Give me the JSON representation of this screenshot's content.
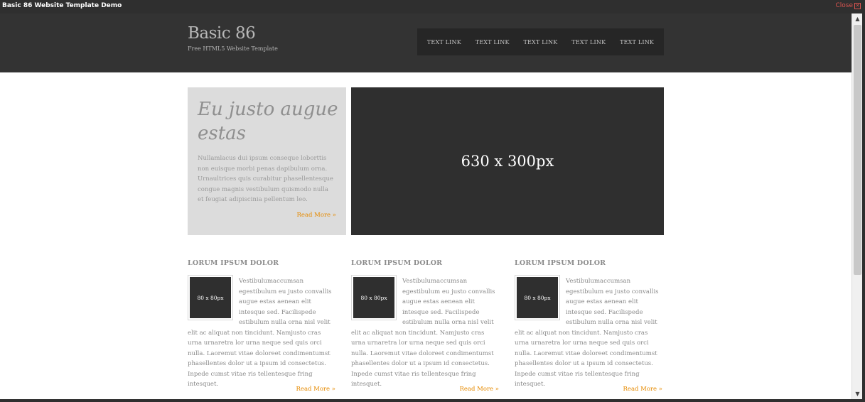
{
  "window": {
    "title": "Basic 86 Website Template Demo",
    "close_label": "Close"
  },
  "site": {
    "logo": "Basic 86",
    "tagline": "Free HTML5 Website Template"
  },
  "nav": [
    "TEXT LINK",
    "TEXT LINK",
    "TEXT LINK",
    "TEXT LINK",
    "TEXT LINK"
  ],
  "intro": {
    "heading": "Eu justo augue estas",
    "body": "Nullamlacus dui ipsum conseque loborttis non euisque morbi penas dapibulum orna. Urnaultrices quis curabitur phasellentesque congue magnis vestibulum quismodo nulla et feugiat adipiscinia pellentum leo.",
    "more": "Read More »"
  },
  "banner": {
    "label": "630 x 300px"
  },
  "columns": [
    {
      "heading": "LORUM IPSUM DOLOR",
      "thumb": "80 x 80px",
      "body": "Vestibulumaccumsan egestibulum eu justo convallis augue estas aenean elit intesque sed. Facilispede estibulum nulla orna nisl velit elit ac aliquat non tincidunt. Namjusto cras urna urnaretra lor urna neque sed quis orci nulla. Laoremut vitae doloreet condimentumst phasellentes dolor ut a ipsum id consectetus. Inpede cumst vitae ris tellentesque fring intesquet.",
      "more": "Read More »"
    },
    {
      "heading": "LORUM IPSUM DOLOR",
      "thumb": "80 x 80px",
      "body": "Vestibulumaccumsan egestibulum eu justo convallis augue estas aenean elit intesque sed. Facilispede estibulum nulla orna nisl velit elit ac aliquat non tincidunt. Namjusto cras urna urnaretra lor urna neque sed quis orci nulla. Laoremut vitae doloreet condimentumst phasellentes dolor ut a ipsum id consectetus. Inpede cumst vitae ris tellentesque fring intesquet.",
      "more": "Read More »"
    },
    {
      "heading": "LORUM IPSUM DOLOR",
      "thumb": "80 x 80px",
      "body": "Vestibulumaccumsan egestibulum eu justo convallis augue estas aenean elit intesque sed. Facilispede estibulum nulla orna nisl velit elit ac aliquat non tincidunt. Namjusto cras urna urnaretra lor urna neque sed quis orci nulla. Laoremut vitae doloreet condimentumst phasellentes dolor ut a ipsum id consectetus. Inpede cumst vitae ris tellentesque fring intesquet.",
      "more": "Read More »"
    }
  ],
  "colors": {
    "header_bg": "#333333",
    "accent": "#e68a00",
    "intro_bg": "#dcdcdc",
    "banner_bg": "#2f2f2f"
  }
}
